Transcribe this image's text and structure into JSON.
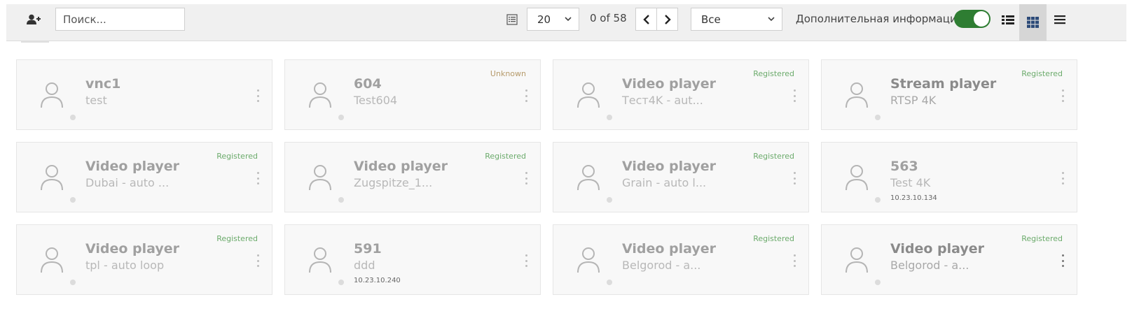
{
  "toolbar": {
    "add_user_icon": "add-user-icon",
    "search_placeholder": "Поиск...",
    "per_page": "20",
    "counter": "0 of 58",
    "filter": "Все",
    "info_label": "Дополнительная информация",
    "info_toggle_on": true,
    "accent": "#2e7d32"
  },
  "cards": [
    {
      "title": "vnc1",
      "subtitle": "test",
      "status": "",
      "ip": ""
    },
    {
      "title": "604",
      "subtitle": "Test604",
      "status": "Unknown",
      "ip": ""
    },
    {
      "title": "Video player",
      "subtitle": "Тест4K - aut...",
      "status": "Registered",
      "ip": ""
    },
    {
      "title": "Stream player",
      "subtitle": "RTSP 4K",
      "status": "Registered",
      "ip": ""
    },
    {
      "title": "Video player",
      "subtitle": "Dubai - auto ...",
      "status": "Registered",
      "ip": ""
    },
    {
      "title": "Video player",
      "subtitle": "Zugspitze_1...",
      "status": "Registered",
      "ip": ""
    },
    {
      "title": "Video player",
      "subtitle": "Grain - auto l...",
      "status": "Registered",
      "ip": ""
    },
    {
      "title": "563",
      "subtitle": "Test 4K",
      "status": "",
      "ip": "10.23.10.134"
    },
    {
      "title": "Video player",
      "subtitle": "tpl - auto loop",
      "status": "Registered",
      "ip": ""
    },
    {
      "title": "591",
      "subtitle": "ddd",
      "status": "",
      "ip": "10.23.10.240"
    },
    {
      "title": "Video player",
      "subtitle": "Belgorod - a...",
      "status": "Registered",
      "ip": ""
    },
    {
      "title": "Video player",
      "subtitle": "Belgorod - a...",
      "status": "Registered",
      "ip": ""
    }
  ]
}
